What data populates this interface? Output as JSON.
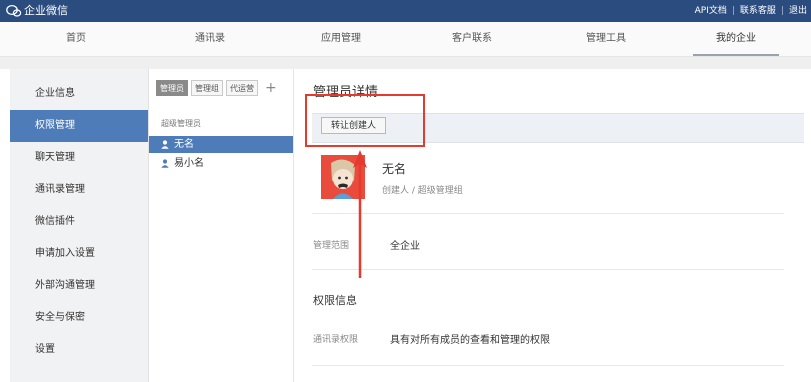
{
  "app": {
    "title": "企业微信",
    "links": [
      "API文档",
      "联系客服",
      "退出"
    ]
  },
  "nav": {
    "items": [
      "首页",
      "通讯录",
      "应用管理",
      "客户联系",
      "管理工具",
      "我的企业"
    ],
    "active_index": 5
  },
  "sidebar": {
    "items": [
      "企业信息",
      "权限管理",
      "聊天管理",
      "通讯录管理",
      "微信插件",
      "申请加入设置",
      "外部沟通管理",
      "安全与保密",
      "设置"
    ],
    "active_index": 1
  },
  "admin_list": {
    "tabs": [
      "管理员",
      "管理组",
      "代运营"
    ],
    "add_label": "+",
    "group_label": "超级管理员",
    "admins": [
      "无名",
      "易小名"
    ],
    "selected_index": 0
  },
  "detail": {
    "title": "管理员详情",
    "transfer_button": "转让创建人",
    "name": "无名",
    "role": "创建人 / 超级管理组",
    "scope_label": "管理范围",
    "scope_value": "全企业",
    "permissions_title": "权限信息",
    "contacts_perm_label": "通讯录权限",
    "contacts_perm_value": "具有对所有成员的查看和管理的权限"
  },
  "colors": {
    "topbar": "#2b4c7e",
    "accent": "#4e7cb8",
    "annotation": "#e53a2e"
  },
  "icons": {
    "logo": "chat-bubbles-icon",
    "user": "user-icon",
    "arrow": "arrow-up-icon"
  }
}
